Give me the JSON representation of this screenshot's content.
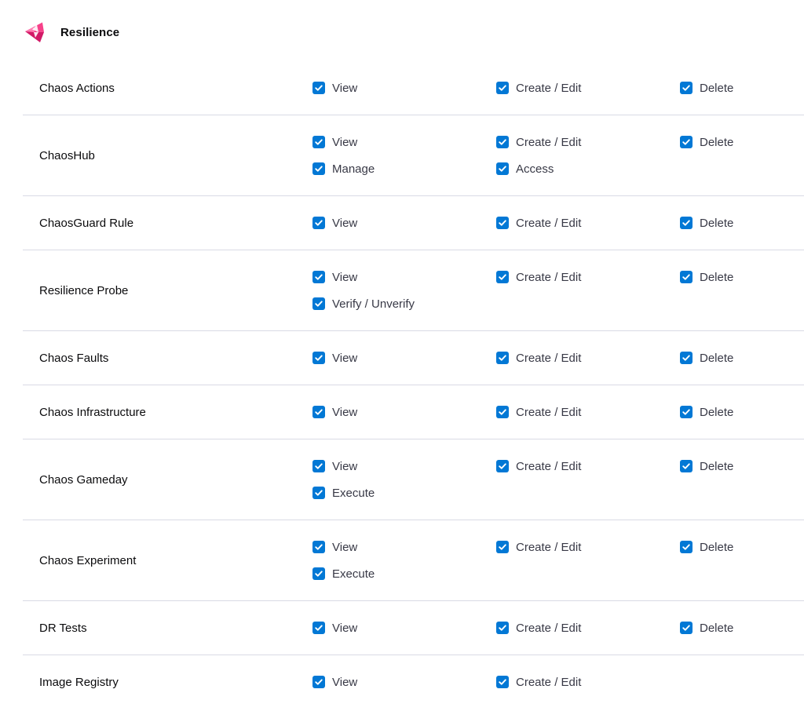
{
  "section": {
    "title": "Resilience",
    "icon": "resilience-logo-icon",
    "brand_color": "#EE2A7B"
  },
  "colors": {
    "checkbox": "#0278D5",
    "divider": "#D9DAE5"
  },
  "rows": [
    {
      "name": "Chaos Actions",
      "col1": [
        "View"
      ],
      "col2": [
        "Create / Edit"
      ],
      "col3": [
        "Delete"
      ]
    },
    {
      "name": "ChaosHub",
      "col1": [
        "View",
        "Manage"
      ],
      "col2": [
        "Create / Edit",
        "Access"
      ],
      "col3": [
        "Delete"
      ]
    },
    {
      "name": "ChaosGuard Rule",
      "col1": [
        "View"
      ],
      "col2": [
        "Create / Edit"
      ],
      "col3": [
        "Delete"
      ]
    },
    {
      "name": "Resilience Probe",
      "col1": [
        "View",
        "Verify / Unverify"
      ],
      "col2": [
        "Create / Edit"
      ],
      "col3": [
        "Delete"
      ]
    },
    {
      "name": "Chaos Faults",
      "col1": [
        "View"
      ],
      "col2": [
        "Create / Edit"
      ],
      "col3": [
        "Delete"
      ]
    },
    {
      "name": "Chaos Infrastructure",
      "col1": [
        "View"
      ],
      "col2": [
        "Create / Edit"
      ],
      "col3": [
        "Delete"
      ]
    },
    {
      "name": "Chaos Gameday",
      "col1": [
        "View",
        "Execute"
      ],
      "col2": [
        "Create / Edit"
      ],
      "col3": [
        "Delete"
      ]
    },
    {
      "name": "Chaos Experiment",
      "col1": [
        "View",
        "Execute"
      ],
      "col2": [
        "Create / Edit"
      ],
      "col3": [
        "Delete"
      ]
    },
    {
      "name": "DR Tests",
      "col1": [
        "View"
      ],
      "col2": [
        "Create / Edit"
      ],
      "col3": [
        "Delete"
      ]
    },
    {
      "name": "Image Registry",
      "col1": [
        "View"
      ],
      "col2": [
        "Create / Edit"
      ],
      "col3": []
    }
  ],
  "all_checked": true
}
